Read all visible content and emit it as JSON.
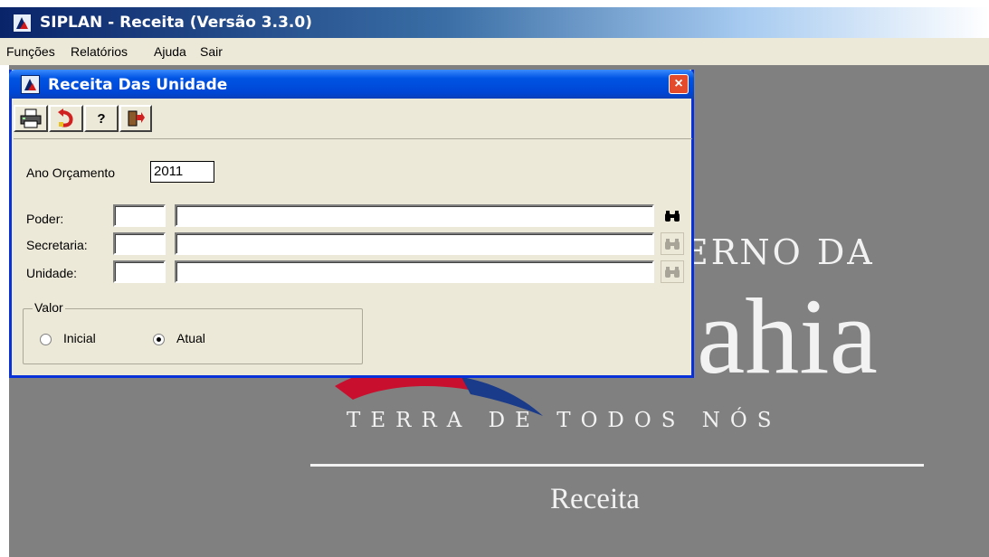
{
  "app": {
    "title": "SIPLAN - Receita (Versão 3.3.0)",
    "menu": [
      "Funções",
      "Relatórios",
      "Ajuda",
      "Sair"
    ]
  },
  "background": {
    "brand_top": "ERNO DA",
    "brand_big": "ahia",
    "tagline": "TERRA DE TODOS NÓS",
    "module": "Receita"
  },
  "dialog": {
    "title": "Receita Das Unidade",
    "close_label": "×",
    "toolbar": {
      "print_icon": "printer-icon",
      "undo_icon": "undo-icon",
      "help_label": "?",
      "exit_icon": "exit-door-icon"
    },
    "ano_label": "Ano Orçamento",
    "ano_value": "2011",
    "fields": [
      {
        "label": "Poder:",
        "code": "",
        "name": "",
        "search_enabled": true
      },
      {
        "label": "Secretaria:",
        "code": "",
        "name": "",
        "search_enabled": false
      },
      {
        "label": "Unidade:",
        "code": "",
        "name": "",
        "search_enabled": false
      }
    ],
    "valor": {
      "legend": "Valor",
      "options": [
        {
          "label": "Inicial",
          "selected": false
        },
        {
          "label": "Atual",
          "selected": true
        }
      ]
    }
  },
  "colors": {
    "titlebar": "#0054e3",
    "dialog_bg": "#ece9d8",
    "desktop_bg": "#808080",
    "close": "#e44b2b"
  }
}
